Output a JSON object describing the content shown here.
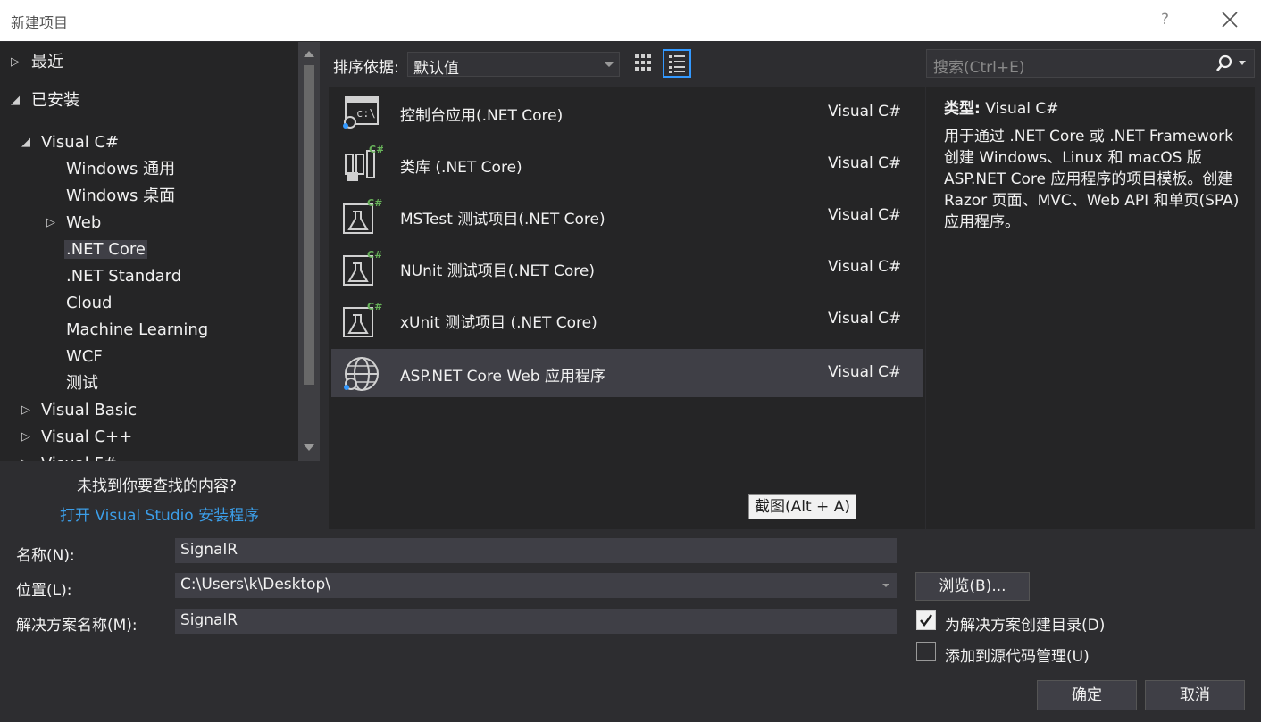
{
  "window": {
    "title": "新建项目",
    "help": "?"
  },
  "tree": {
    "recent": "最近",
    "installed": "已安装",
    "visual_csharp": "Visual C#",
    "windows_universal": "Windows 通用",
    "windows_desktop": "Windows 桌面",
    "web": "Web",
    "net_core": ".NET Core",
    "net_standard": ".NET Standard",
    "cloud": "Cloud",
    "machine_learning": "Machine Learning",
    "wcf": "WCF",
    "test": "测试",
    "visual_basic": "Visual Basic",
    "visual_cpp": "Visual C++",
    "visual_fsharp": "Visual F#"
  },
  "not_found": "未找到你要查找的内容?",
  "open_installer": "打开 Visual Studio 安装程序",
  "sort": {
    "label": "排序依据:",
    "value": "默认值"
  },
  "search": {
    "placeholder": "搜索(Ctrl+E)"
  },
  "templates": [
    {
      "name": "控制台应用(.NET Core)",
      "lang": "Visual C#"
    },
    {
      "name": "类库 (.NET Core)",
      "lang": "Visual C#"
    },
    {
      "name": "MSTest 测试项目(.NET Core)",
      "lang": "Visual C#"
    },
    {
      "name": "NUnit 测试项目(.NET Core)",
      "lang": "Visual C#"
    },
    {
      "name": "xUnit 测试项目 (.NET Core)",
      "lang": "Visual C#"
    },
    {
      "name": "ASP.NET Core Web 应用程序",
      "lang": "Visual C#"
    }
  ],
  "tooltip": "截图(Alt + A)",
  "description": {
    "type_label": "类型:",
    "type_value": "Visual C#",
    "text": "用于通过 .NET Core 或 .NET Framework 创建 Windows、Linux 和 macOS 版 ASP.NET Core 应用程序的项目模板。创建 Razor 页面、MVC、Web API 和单页(SPA)应用程序。"
  },
  "form": {
    "name_label": "名称(N):",
    "name_value": "SignalR",
    "location_label": "位置(L):",
    "location_value": "C:\\Users\\k\\Desktop\\",
    "solution_label": "解决方案名称(M):",
    "solution_value": "SignalR",
    "browse": "浏览(B)...",
    "create_dir_label": "为解决方案创建目录(D)",
    "create_dir_checked": true,
    "source_control_label": "添加到源代码管理(U)",
    "source_control_checked": false,
    "ok": "确定",
    "cancel": "取消"
  },
  "colors": {
    "accent": "#3399ff",
    "link": "#3c9ee8",
    "csharp_badge": "#68b35a"
  }
}
